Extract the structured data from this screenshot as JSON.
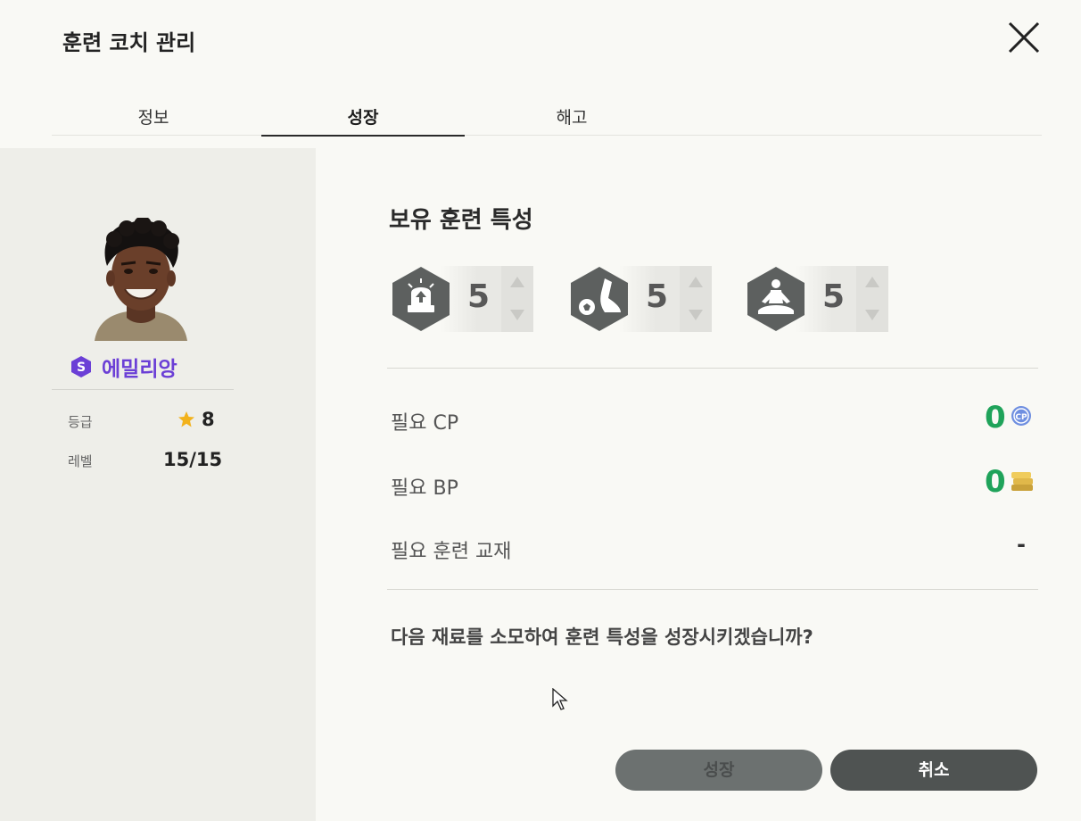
{
  "modal": {
    "title": "훈련 코치 관리"
  },
  "tabs": [
    {
      "label": "정보",
      "active": false
    },
    {
      "label": "성장",
      "active": true
    },
    {
      "label": "해고",
      "active": false
    }
  ],
  "coach": {
    "name": "에밀리앙",
    "grade_badge": "S",
    "grade_label": "등급",
    "grade_value": "8",
    "level_label": "레벨",
    "level_value": "15/15"
  },
  "traits_section": {
    "title": "보유 훈련 특성",
    "traits": [
      {
        "icon": "alarm-siren-icon",
        "level": "5"
      },
      {
        "icon": "kicking-foot-ball-icon",
        "level": "5"
      },
      {
        "icon": "meditation-icon",
        "level": "5"
      }
    ]
  },
  "requirements": {
    "cp": {
      "label": "필요 CP",
      "value": "0",
      "icon": "cp-coin-icon"
    },
    "bp": {
      "label": "필요 BP",
      "value": "0",
      "icon": "bp-coin-stack-icon"
    },
    "material": {
      "label": "필요 훈련 교재",
      "value": "-"
    }
  },
  "confirm_text": "다음 재료를 소모하여 훈련 특성을 성장시키겠습니까?",
  "buttons": {
    "grow": "성장",
    "cancel": "취소"
  },
  "colors": {
    "accent_purple": "#6b3fd6",
    "value_green": "#1fa35a",
    "star_gold": "#f2b21c",
    "button_dark": "#4f5352"
  }
}
